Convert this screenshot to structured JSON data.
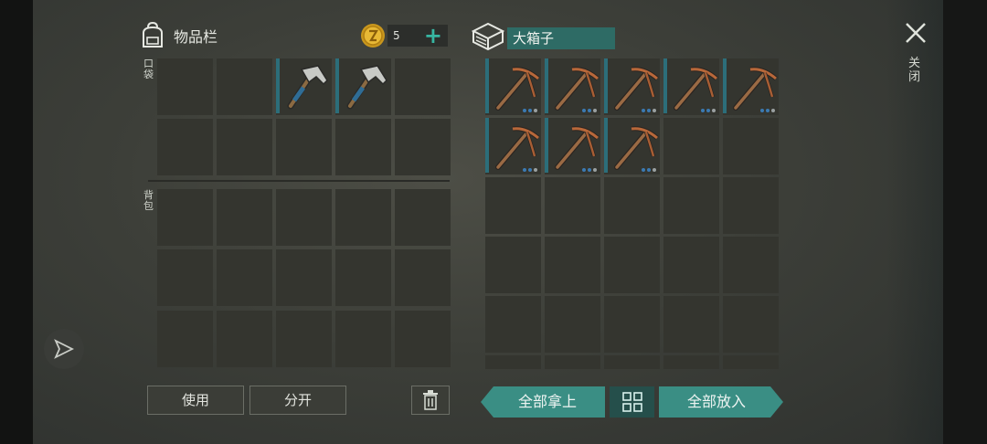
{
  "inventory": {
    "title": "物品栏",
    "gold": "5",
    "section_pocket": "口袋",
    "section_backpack": "背包",
    "use_label": "使用",
    "split_label": "分开"
  },
  "box": {
    "name": "大箱子",
    "take_all_label": "全部拿上",
    "put_all_label": "全部放入"
  },
  "close_label": "关闭",
  "pocket_items": [
    "",
    "",
    "hammer-icon",
    "hammer-icon",
    "",
    "",
    "",
    "",
    "",
    ""
  ],
  "box_items": [
    "pickaxe-icon",
    "pickaxe-icon",
    "pickaxe-icon",
    "pickaxe-icon",
    "pickaxe-icon",
    "pickaxe-icon",
    "pickaxe-icon",
    "pickaxe-icon"
  ],
  "colors": {
    "accent": "#3a8e84",
    "plus": "#37b6a2",
    "name_bg": "#2e6b65",
    "durability": "#3b7ab2"
  }
}
